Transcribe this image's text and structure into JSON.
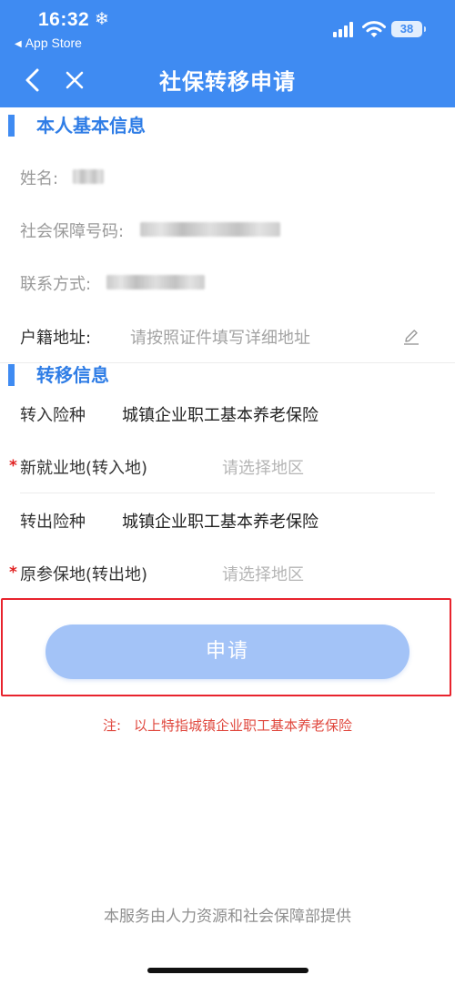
{
  "status": {
    "time": "16:32",
    "back_app": "App Store",
    "battery": "38"
  },
  "nav": {
    "title": "社保转移申请"
  },
  "personal": {
    "section_title": "本人基本信息",
    "name_label": "姓名:",
    "ssn_label": "社会保障号码:",
    "phone_label": "联系方式:",
    "address_label": "户籍地址:",
    "address_placeholder": "请按照证件填写详细地址"
  },
  "transfer": {
    "section_title": "转移信息",
    "in_type_label": "转入险种",
    "in_type_value": "城镇企业职工基本养老保险",
    "new_place_label": "新就业地(转入地)",
    "new_place_placeholder": "请选择地区",
    "out_type_label": "转出险种",
    "out_type_value": "城镇企业职工基本养老保险",
    "orig_place_label": "原参保地(转出地)",
    "orig_place_placeholder": "请选择地区",
    "required_mark": "*"
  },
  "actions": {
    "apply_label": "申请"
  },
  "note": {
    "prefix": "注:",
    "text": "以上特指城镇企业职工基本养老保险"
  },
  "footer": {
    "text": "本服务由人力资源和社会保障部提供"
  },
  "icons": {
    "snow": "❄",
    "back_triangle": "◀"
  },
  "colors": {
    "primary": "#3f8bf2",
    "button_disabled": "#a3c3f7",
    "required": "#e02020",
    "note": "#e0483e",
    "highlight_border": "#e8232d"
  }
}
